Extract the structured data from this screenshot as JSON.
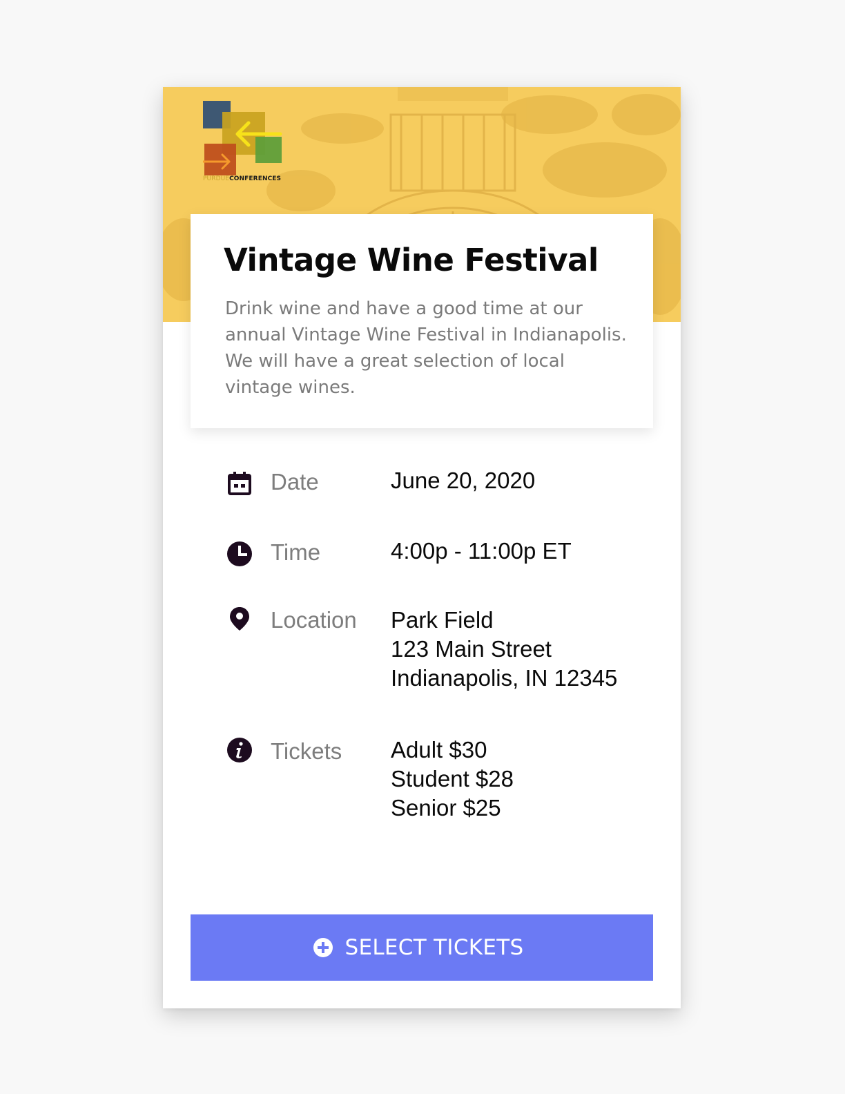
{
  "brand": {
    "logo_word_1": "PURDUE",
    "logo_word_2": "CONFERENCES"
  },
  "event": {
    "title": "Vintage Wine Festival",
    "description": "Drink wine and have a good time at our annual Vintage Wine Festival in Indianapolis. We will have a great selection of local vintage wines."
  },
  "details": {
    "date": {
      "icon": "calendar-icon",
      "label": "Date",
      "value": "June 20, 2020"
    },
    "time": {
      "icon": "clock-icon",
      "label": "Time",
      "value": "4:00p - 11:00p ET"
    },
    "location": {
      "icon": "location-pin-icon",
      "label": "Location",
      "lines": [
        "Park Field",
        "123 Main Street",
        "Indianapolis, IN 12345"
      ]
    },
    "tickets": {
      "icon": "info-icon",
      "label": "Tickets",
      "lines": [
        "Adult $30",
        "Student $28",
        "Senior $25"
      ]
    }
  },
  "cta": {
    "icon": "plus-circle-icon",
    "label": "SELECT TICKETS"
  },
  "colors": {
    "hero_yellow": "#f4c95c",
    "button_blue": "#6b7af4",
    "icon_dark": "#1d0b1f"
  }
}
